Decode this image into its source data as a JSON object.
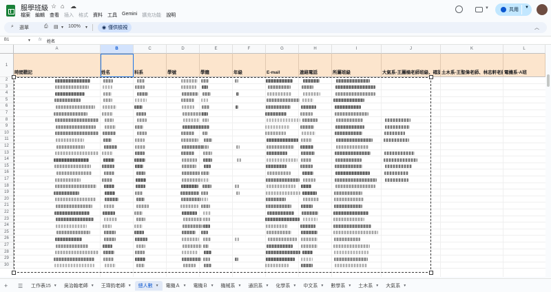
{
  "app": {
    "title": "服學班級"
  },
  "menu": [
    "檔案",
    "編輯",
    "查看",
    "插入",
    "格式",
    "資料",
    "工具",
    "Gemini",
    "擴充功能",
    "說明"
  ],
  "menu_disabled": [
    3,
    4,
    8
  ],
  "share": {
    "label": "共用"
  },
  "toolbar": {
    "search": "選單",
    "zoom": "100%",
    "mode": "僅供檢視"
  },
  "formula": {
    "cell": "B1",
    "fx": "fx",
    "value": "姓名"
  },
  "columns": [
    "A",
    "B",
    "C",
    "D",
    "E",
    "F",
    "G",
    "H",
    "I",
    "J",
    "K",
    "L"
  ],
  "selected_column": "B",
  "header_row": [
    "時間戳記",
    "姓名",
    "科系",
    "學號",
    "學籍",
    "年級",
    "E-mail",
    "連絡電話",
    "所屬班級",
    "大氣系-王麗楠老師班級、確認",
    "土木系-王聖偉老師、林志軒老師",
    "電機系-A班"
  ],
  "row_numbers": [
    1,
    2,
    3,
    4,
    5,
    6,
    7,
    8,
    9,
    10,
    11,
    12,
    13,
    14,
    15,
    16,
    17,
    18,
    19,
    20,
    21,
    22,
    23,
    24,
    25,
    26,
    27,
    28,
    29,
    30
  ],
  "sheets": [
    {
      "label": "工作表15"
    },
    {
      "label": "吳治翰老師"
    },
    {
      "label": "王瑋鈞老師"
    },
    {
      "label": "總人數"
    },
    {
      "label": "電機Ａ"
    },
    {
      "label": "電機Ｂ"
    },
    {
      "label": "機械系"
    },
    {
      "label": "通訊系"
    },
    {
      "label": "化學系"
    },
    {
      "label": "中文系"
    },
    {
      "label": "數學系"
    },
    {
      "label": "土木系"
    },
    {
      "label": "大氣系"
    }
  ],
  "active_sheet": 3
}
